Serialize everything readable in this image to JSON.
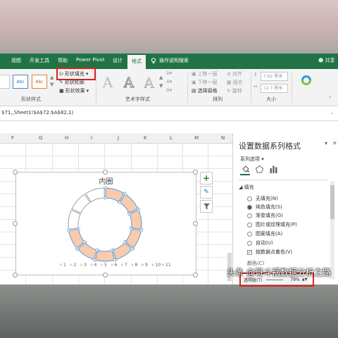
{
  "tabs": [
    "视图",
    "开发工具",
    "帮助",
    "Power Pivot",
    "设计",
    "格式"
  ],
  "active_tab": "格式",
  "tell_me": "操作说明搜索",
  "share": "共享",
  "ribbon": {
    "shape_styles_group": "形状样式",
    "style_samples": [
      "Abc",
      "Abc",
      "Abc"
    ],
    "shape_fill": "形状填充",
    "shape_outline": "形状轮廓",
    "shape_effects": "形状效果",
    "wordart_group": "艺术字样式",
    "wordart_sample": "A",
    "arrange_group": "排列",
    "bring_forward": "上移一层",
    "send_backward": "下移一层",
    "selection_pane": "选择窗格",
    "align": "对齐",
    "group": "组合",
    "rotate": "旋转",
    "size_group": "大小",
    "height_value": "7.62 厘米",
    "width_value": "12.7 厘米"
  },
  "formula": "$71,,Sheet1!$A$72:$A$82,1)",
  "columns": [
    "F",
    "G",
    "H",
    "I",
    "J",
    "K",
    "L",
    "M",
    "N"
  ],
  "chart": {
    "title": "内圈",
    "legend_items": [
      "1",
      "2",
      "3",
      "4",
      "5",
      "6",
      "7",
      "8",
      "9",
      "10",
      "11"
    ],
    "segment_color": "#f8cbad",
    "selected_segments": 8,
    "total_segments": 11
  },
  "pane": {
    "title": "设置数据系列格式",
    "series_options": "系列选项",
    "fill_section": "填充",
    "options": [
      "无填充(N)",
      "纯色填充(S)",
      "渐变填充(G)",
      "图片或纹理填充(P)",
      "图案填充(A)",
      "自动(U)"
    ],
    "selected_option": "纯色填充(S)",
    "vary_colors": "按数据点着色(V)",
    "color_label": "颜色(C)",
    "transparency_label": "透明度(T)",
    "transparency_value": "79%"
  },
  "watermark": "头条 @哥斗祸数据分析之路",
  "colors": {
    "excel_green": "#217346",
    "highlight_red": "#e0201a",
    "accent_blue": "#5b9bd5"
  }
}
